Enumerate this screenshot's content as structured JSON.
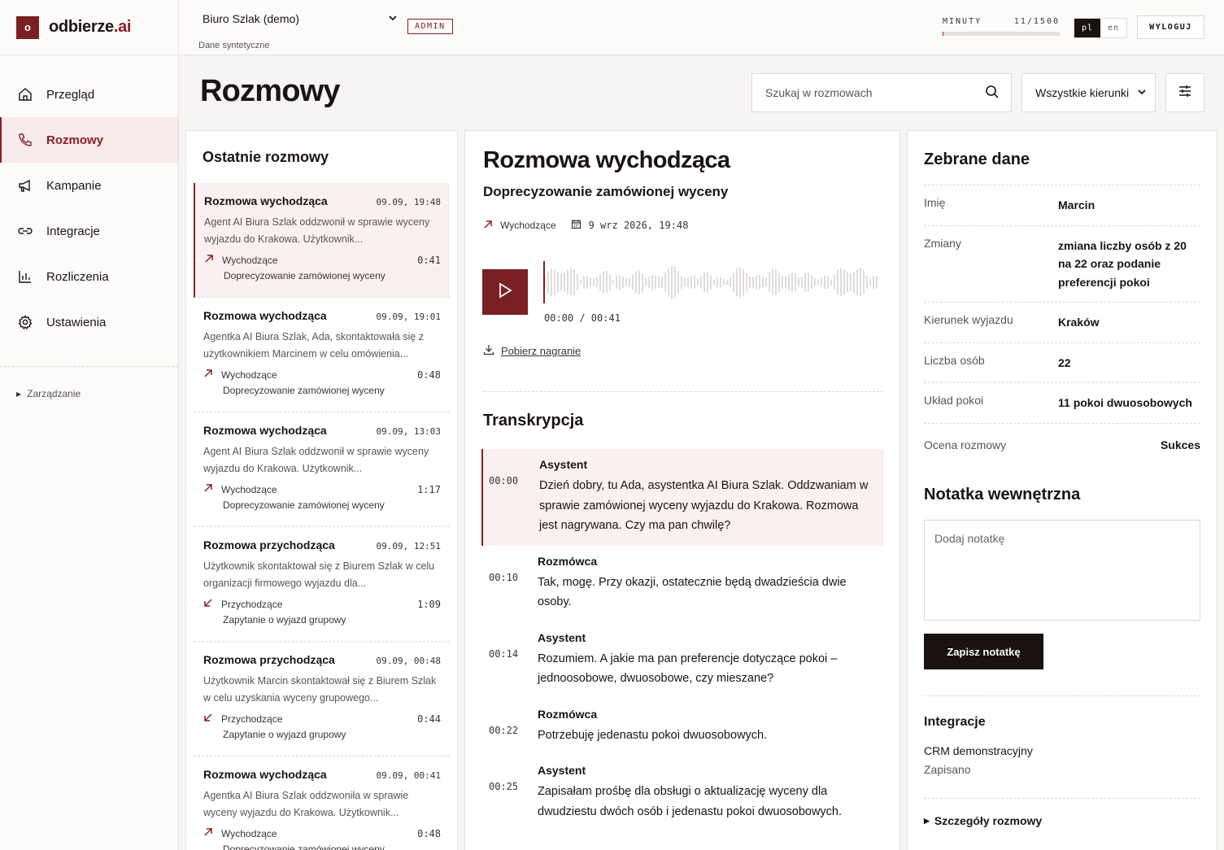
{
  "brand": {
    "mark": "o",
    "name": "odbierze",
    "suffix": ".ai"
  },
  "nav": {
    "items": [
      {
        "label": "Przegląd",
        "icon": "home-icon"
      },
      {
        "label": "Rozmowy",
        "icon": "phone-icon",
        "active": true
      },
      {
        "label": "Kampanie",
        "icon": "megaphone-icon"
      },
      {
        "label": "Integracje",
        "icon": "link-icon"
      },
      {
        "label": "Rozliczenia",
        "icon": "bar-chart-icon"
      },
      {
        "label": "Ustawienia",
        "icon": "gear-icon"
      }
    ],
    "manage": "Zarządzanie"
  },
  "topbar": {
    "office": "Biuro Szlak (demo)",
    "office_sub": "Dane syntetyczne",
    "role": "ADMIN",
    "minutes_label": "MINUTY",
    "minutes_value": "11/1500",
    "minutes_fraction": 0.0073,
    "lang_active": "pl",
    "lang_other": "en",
    "logout": "WYLOGUJ"
  },
  "page": {
    "title": "Rozmowy",
    "search_placeholder": "Szukaj w rozmowach",
    "direction_filter": "Wszystkie kierunki"
  },
  "list": {
    "title": "Ostatnie rozmowy",
    "items": [
      {
        "title": "Rozmowa wychodząca",
        "time": "09.09, 19:48",
        "desc": "Agent AI Biura Szlak oddzwonił w sprawie wyceny wyjazdu do Krakowa. Użytkownik...",
        "direction": "Wychodzące",
        "dir": "out",
        "duration": "0:41",
        "topic": "Doprecyzowanie zamówionej wyceny",
        "active": true
      },
      {
        "title": "Rozmowa wychodząca",
        "time": "09.09, 19:01",
        "desc": "Agentka AI Biura Szlak, Ada, skontaktowała się z użytkownikiem Marcinem w celu omówienia...",
        "direction": "Wychodzące",
        "dir": "out",
        "duration": "0:48",
        "topic": "Doprecyzowanie zamówionej wyceny"
      },
      {
        "title": "Rozmowa wychodząca",
        "time": "09.09, 13:03",
        "desc": "Agent AI Biura Szlak oddzwonił w sprawie wyceny wyjazdu do Krakowa. Użytkownik...",
        "direction": "Wychodzące",
        "dir": "out",
        "duration": "1:17",
        "topic": "Doprecyzowanie zamówionej wyceny"
      },
      {
        "title": "Rozmowa przychodząca",
        "time": "09.09, 12:51",
        "desc": "Użytkownik skontaktował się z Biurem Szlak w celu organizacji firmowego wyjazdu dla...",
        "direction": "Przychodzące",
        "dir": "in",
        "duration": "1:09",
        "topic": "Zapytanie o wyjazd grupowy"
      },
      {
        "title": "Rozmowa przychodząca",
        "time": "09.09, 00:48",
        "desc": "Użytkownik Marcin skontaktował się z Biurem Szlak w celu uzyskania wyceny grupowego...",
        "direction": "Przychodzące",
        "dir": "in",
        "duration": "0:44",
        "topic": "Zapytanie o wyjazd grupowy"
      },
      {
        "title": "Rozmowa wychodząca",
        "time": "09.09, 00:41",
        "desc": "Agentka AI Biura Szlak oddzwoniła w sprawie wyceny wyjazdu do Krakowa. Użytkownik...",
        "direction": "Wychodzące",
        "dir": "out",
        "duration": "0:48",
        "topic": "Doprecyzowanie zamówionej wyceny"
      }
    ]
  },
  "detail": {
    "title": "Rozmowa wychodząca",
    "subtitle": "Doprecyzowanie zamówionej wyceny",
    "direction": "Wychodzące",
    "date": "9 wrz 2026, 19:48",
    "player_time": "00:00 / 00:41",
    "download": "Pobierz nagranie",
    "transcript_title": "Transkrypcja",
    "transcript": [
      {
        "time": "00:00",
        "speaker": "Asystent",
        "text": "Dzień dobry, tu Ada, asystentka AI Biura Szlak. Oddzwaniam w sprawie zamówionej wyceny wyjazdu do Krakowa. Rozmowa jest nagrywana. Czy ma pan chwilę?",
        "active": true
      },
      {
        "time": "00:10",
        "speaker": "Rozmówca",
        "text": "Tak, mogę. Przy okazji, ostatecznie będą dwadzieścia dwie osoby."
      },
      {
        "time": "00:14",
        "speaker": "Asystent",
        "text": "Rozumiem. A jakie ma pan preferencje dotyczące pokoi – jednoosobowe, dwuosobowe, czy mieszane?"
      },
      {
        "time": "00:22",
        "speaker": "Rozmówca",
        "text": "Potrzebuję jedenastu pokoi dwuosobowych."
      },
      {
        "time": "00:25",
        "speaker": "Asystent",
        "text": "Zapisałam prośbę dla obsługi o aktualizację wyceny dla dwudziestu dwóch osób i jedenastu pokoi dwuosobowych."
      }
    ]
  },
  "collected": {
    "title": "Zebrane dane",
    "fields": [
      {
        "k": "Imię",
        "v": "Marcin"
      },
      {
        "k": "Zmiany",
        "v": "zmiana liczby osób z 20 na 22 oraz podanie preferencji pokoi"
      },
      {
        "k": "Kierunek wyjazdu",
        "v": "Kraków"
      },
      {
        "k": "Liczba osób",
        "v": "22"
      },
      {
        "k": "Układ pokoi",
        "v": "11 pokoi dwuosobowych"
      }
    ],
    "rating_label": "Ocena rozmowy",
    "rating_value": "Sukces",
    "note_title": "Notatka wewnętrzna",
    "note_placeholder": "Dodaj notatkę",
    "note_button": "Zapisz notatkę",
    "integrations_title": "Integracje",
    "integration_name": "CRM demonstracyjny",
    "integration_status": "Zapisano",
    "details_toggle": "Szczegóły rozmowy"
  },
  "colors": {
    "accent": "#8a1f25",
    "dark": "#1a1111"
  }
}
